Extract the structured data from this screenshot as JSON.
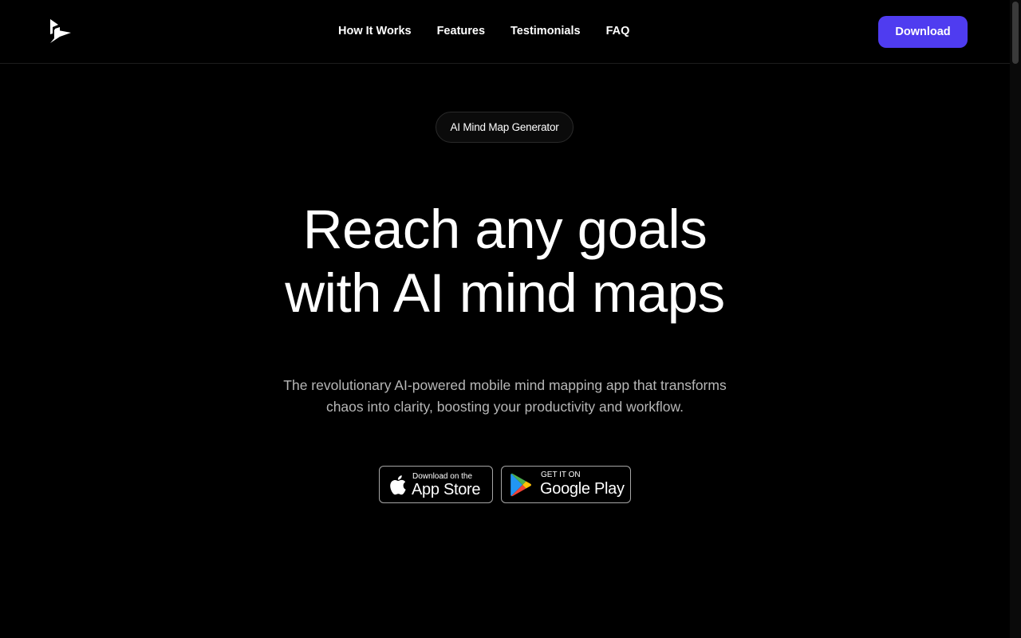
{
  "nav": {
    "items": [
      {
        "label": "How It Works"
      },
      {
        "label": "Features"
      },
      {
        "label": "Testimonials"
      },
      {
        "label": "FAQ"
      }
    ],
    "cta_label": "Download"
  },
  "hero": {
    "badge": "AI Mind Map Generator",
    "headline_line1": "Reach any goals",
    "headline_line2": "with AI mind maps",
    "subtext_line1": "The revolutionary AI-powered mobile mind mapping app that transforms",
    "subtext_line2": "chaos into clarity, boosting your productivity and workflow."
  },
  "stores": {
    "appstore_small": "Download on the",
    "appstore_big": "App Store",
    "googleplay_small": "GET IT ON",
    "googleplay_big": "Google Play"
  },
  "colors": {
    "background": "#000000",
    "accent": "#4f3cf0",
    "subtext": "#b7b7b7"
  },
  "icons": [
    "logo-icon",
    "apple-icon",
    "google-play-icon"
  ]
}
